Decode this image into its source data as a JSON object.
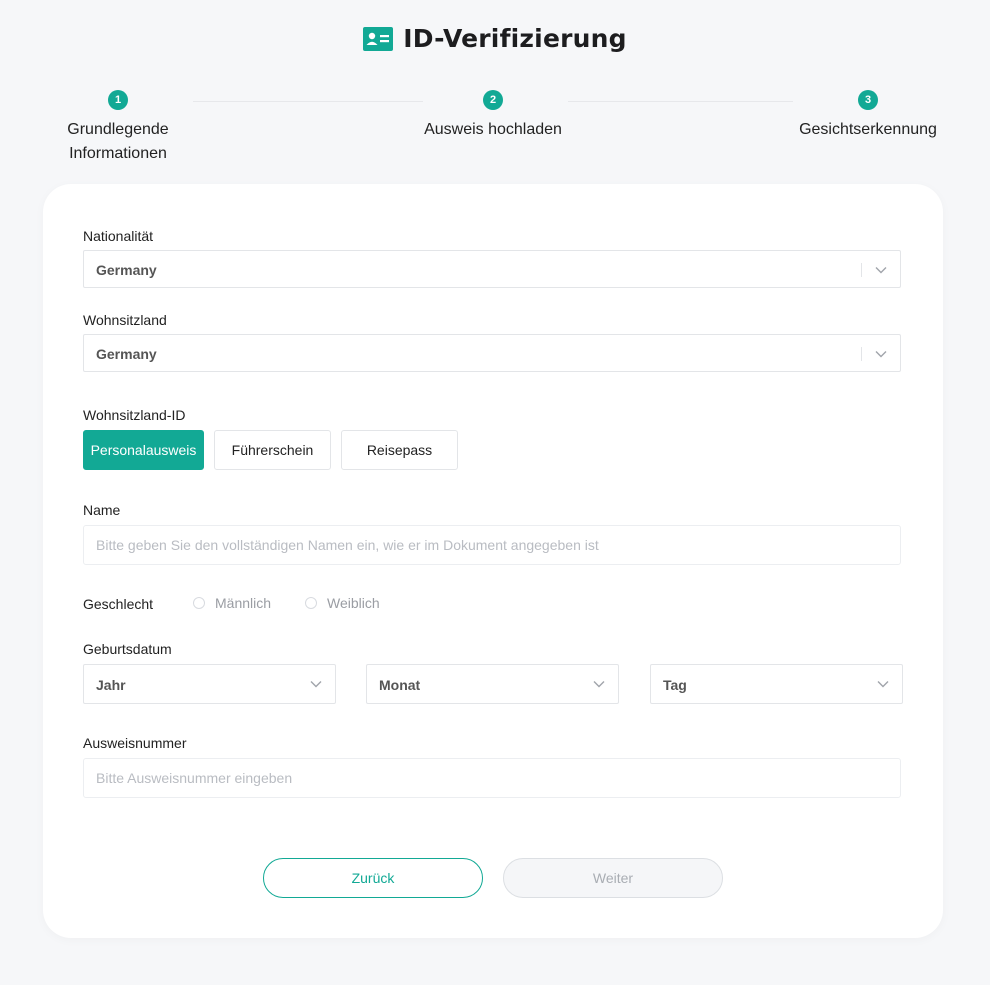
{
  "header": {
    "title": "ID-Verifizierung",
    "icon": "id-card-icon",
    "accent": "#12a995"
  },
  "steps": [
    {
      "number": "1",
      "label_line1": "Grundlegende",
      "label_line2": "Informationen"
    },
    {
      "number": "2",
      "label_line1": "Ausweis hochladen",
      "label_line2": ""
    },
    {
      "number": "3",
      "label_line1": "Gesichtserkennung",
      "label_line2": ""
    }
  ],
  "form": {
    "nationality": {
      "label": "Nationalität",
      "value": "Germany"
    },
    "residence": {
      "label": "Wohnsitzland",
      "value": "Germany"
    },
    "id_type": {
      "label": "Wohnsitzland-ID",
      "options": [
        "Personalausweis",
        "Führerschein",
        "Reisepass"
      ],
      "selected": "Personalausweis"
    },
    "name": {
      "label": "Name",
      "value": "",
      "placeholder": "Bitte geben Sie den vollständigen Namen ein, wie er im Dokument angegeben ist"
    },
    "gender": {
      "label": "Geschlecht",
      "options": [
        "Männlich",
        "Weiblich"
      ],
      "selected": ""
    },
    "birthdate": {
      "label": "Geburtsdatum",
      "year": "Jahr",
      "month": "Monat",
      "day": "Tag"
    },
    "id_number": {
      "label": "Ausweisnummer",
      "value": "",
      "placeholder": "Bitte Ausweisnummer eingeben"
    }
  },
  "buttons": {
    "back": "Zurück",
    "next": "Weiter"
  }
}
